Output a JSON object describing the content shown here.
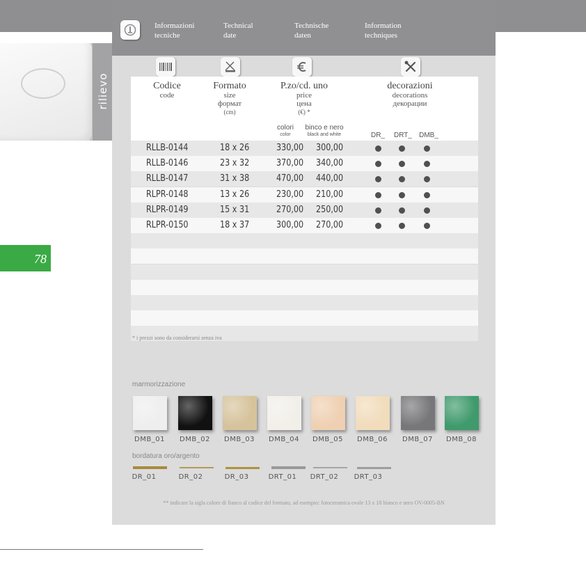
{
  "section_label": "rilievo",
  "page_number": "78",
  "header": {
    "labels": [
      {
        "line1": "Informazioni",
        "line2": "tecniche"
      },
      {
        "line1": "Technical",
        "line2": "date"
      },
      {
        "line1": "Technische",
        "line2": "daten"
      },
      {
        "line1": "Information",
        "line2": "techniques"
      }
    ]
  },
  "columns": {
    "code": {
      "main": "Codice",
      "sub": "code"
    },
    "size": {
      "main": "Formato",
      "sub1": "size",
      "sub2": "формат",
      "sub3": "(cm)"
    },
    "price": {
      "main": "P.zo/cd. uno",
      "sub1": "price",
      "sub2": "цена",
      "sub3": "(€) *",
      "color_label": "colori",
      "color_sub": "color",
      "bw_label": "binco e nero",
      "bw_sub": "black and white"
    },
    "decorations": {
      "main": "decorazioni",
      "sub1": "decorations",
      "sub2": "декорации",
      "options": [
        "DR_",
        "DRT_",
        "DMB_"
      ]
    }
  },
  "rows": [
    {
      "code": "RLLB-0144",
      "size": "18 x 26",
      "price_color": "330,00",
      "price_bw": "300,00",
      "dr": true,
      "drt": true,
      "dmb": true
    },
    {
      "code": "RLLB-0146",
      "size": "23 x 32",
      "price_color": "370,00",
      "price_bw": "340,00",
      "dr": true,
      "drt": true,
      "dmb": true
    },
    {
      "code": "RLLB-0147",
      "size": "31 x 38",
      "price_color": "470,00",
      "price_bw": "440,00",
      "dr": true,
      "drt": true,
      "dmb": true
    },
    {
      "code": "RLPR-0148",
      "size": "13 x 26",
      "price_color": "230,00",
      "price_bw": "210,00",
      "dr": true,
      "drt": true,
      "dmb": true
    },
    {
      "code": "RLPR-0149",
      "size": "15 x 31",
      "price_color": "270,00",
      "price_bw": "250,00",
      "dr": true,
      "drt": true,
      "dmb": true
    },
    {
      "code": "RLPR-0150",
      "size": "18 x 37",
      "price_color": "300,00",
      "price_bw": "270,00",
      "dr": true,
      "drt": true,
      "dmb": true
    }
  ],
  "empty_rows": 7,
  "vat_note": "* i prezzi sono da considerarsi senza iva",
  "marble": {
    "title": "marmorizzazione",
    "items": [
      {
        "label": "DMB_01",
        "color": "#eeeeee"
      },
      {
        "label": "DMB_02",
        "color": "#111111"
      },
      {
        "label": "DMB_03",
        "color": "#d6c39c"
      },
      {
        "label": "DMB_04",
        "color": "#f2efe9"
      },
      {
        "label": "DMB_05",
        "color": "#efd0b2"
      },
      {
        "label": "DMB_06",
        "color": "#f1dcbc"
      },
      {
        "label": "DMB_07",
        "color": "#77777a"
      },
      {
        "label": "DMB_08",
        "color": "#3f9a6c"
      }
    ]
  },
  "border": {
    "title": "bordatura oro/argento",
    "items": [
      {
        "label": "DR_01",
        "color": "#a88a3c"
      },
      {
        "label": "DR_02",
        "color": "#b49a56"
      },
      {
        "label": "DR_03",
        "color": "#b0923e"
      },
      {
        "label": "DRT_01",
        "color": "#999999"
      },
      {
        "label": "DRT_02",
        "color": "#a5a5a5"
      },
      {
        "label": "DRT_03",
        "color": "#9d9d9d"
      }
    ]
  },
  "footnote": "** indicare la sigla colore di fianco al codice del formato, ad esempio: fotoceramica ovale 13 x 18 bianco e nero OV-0005-BN",
  "colors": {
    "accent_green": "#3aaa45",
    "header_gray": "#909092",
    "panel_gray": "#dcdcdd"
  }
}
